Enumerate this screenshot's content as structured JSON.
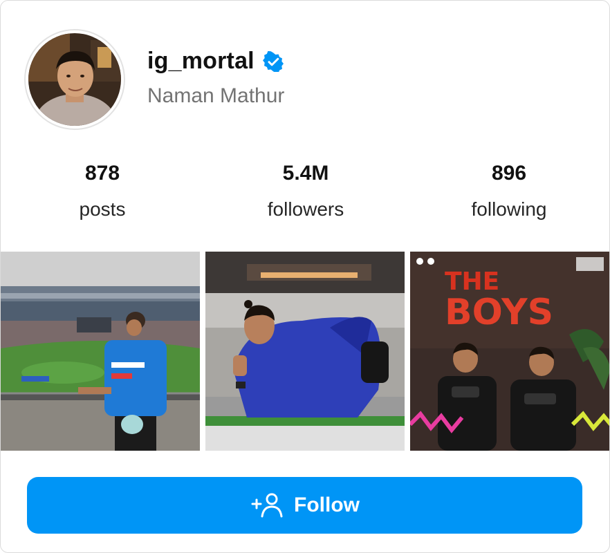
{
  "profile": {
    "username": "ig_mortal",
    "full_name": "Naman Mathur",
    "verified": true,
    "verified_icon": "verified-badge-icon",
    "accent_color": "#0095f6"
  },
  "stats": [
    {
      "value": "878",
      "label": "posts"
    },
    {
      "value": "5.4M",
      "label": "followers"
    },
    {
      "value": "896",
      "label": "following"
    }
  ],
  "posts": [
    {
      "description": "stadium-photo"
    },
    {
      "description": "blanket-photo"
    },
    {
      "description": "the-boys-photo",
      "overlay_text": "THE BOYS"
    }
  ],
  "follow_button": {
    "label": "Follow",
    "icon": "add-person-icon",
    "color": "#0095f6"
  }
}
